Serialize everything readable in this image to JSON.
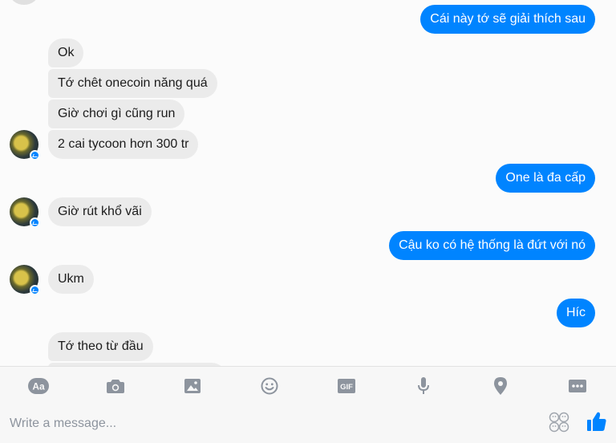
{
  "messages": [
    {
      "dir": "out",
      "text": "Cái này tớ sẽ giải thích sau"
    },
    {
      "dir": "in",
      "text": "Ok"
    },
    {
      "dir": "in",
      "text": "Tớ chêt onecoin năng  quá"
    },
    {
      "dir": "in",
      "text": "Giờ chơi gì cũng run"
    },
    {
      "dir": "in",
      "text": "2 cai tycoon hơn 300 tr"
    },
    {
      "dir": "out",
      "text": "One là đa cấp"
    },
    {
      "dir": "in",
      "text": "Giờ rút khổ vãi"
    },
    {
      "dir": "out",
      "text": "Cậu ko có hệ thống là đứt với nó"
    },
    {
      "dir": "in",
      "text": "Ukm"
    },
    {
      "dir": "out",
      "text": "Híc"
    },
    {
      "dir": "in",
      "text": "Tớ theo từ đầu"
    }
  ],
  "toolbar": {
    "text_format_label": "Aa",
    "gif_label": "GIF",
    "icons": [
      "text-format-icon",
      "camera-icon",
      "image-icon",
      "emoji-icon",
      "gif-icon",
      "microphone-icon",
      "location-pin-icon",
      "more-icon"
    ]
  },
  "composer": {
    "placeholder": "Write a message...",
    "value": ""
  },
  "colors": {
    "outgoing_bubble": "#0084ff",
    "incoming_bubble": "#ebebeb",
    "accent": "#0084ff"
  }
}
